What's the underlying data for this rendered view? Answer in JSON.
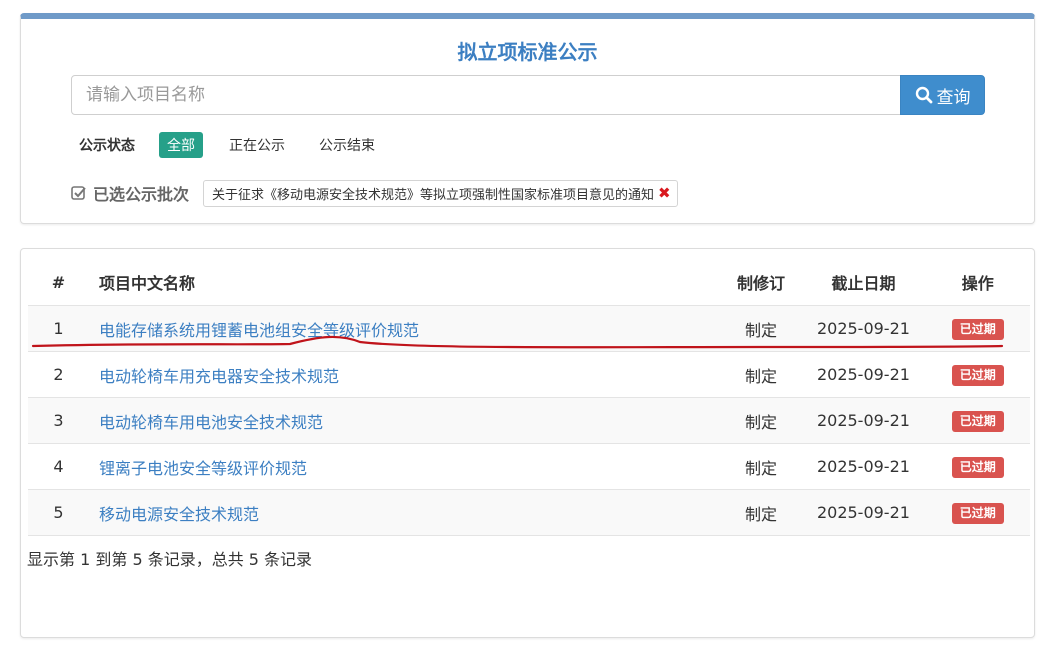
{
  "header": {
    "title": "拟立项标准公示",
    "search_placeholder": "请输入项目名称",
    "search_button": "查询"
  },
  "status_filter": {
    "label": "公示状态",
    "options": [
      "全部",
      "正在公示",
      "公示结束"
    ],
    "active_index": 0
  },
  "batch": {
    "label": "已选公示批次",
    "tag": "关于征求《移动电源安全技术规范》等拟立项强制性国家标准项目意见的通知",
    "tag_remove": "✖"
  },
  "table": {
    "columns": [
      "#",
      "项目中文名称",
      "制修订",
      "截止日期",
      "操作"
    ],
    "rows": [
      {
        "num": "1",
        "name": "电能存储系统用锂蓄电池组安全等级评价规范",
        "revision": "制定",
        "deadline": "2025-09-21",
        "status": "已过期"
      },
      {
        "num": "2",
        "name": "电动轮椅车用充电器安全技术规范",
        "revision": "制定",
        "deadline": "2025-09-21",
        "status": "已过期"
      },
      {
        "num": "3",
        "name": "电动轮椅车用电池安全技术规范",
        "revision": "制定",
        "deadline": "2025-09-21",
        "status": "已过期"
      },
      {
        "num": "4",
        "name": "锂离子电池安全等级评价规范",
        "revision": "制定",
        "deadline": "2025-09-21",
        "status": "已过期"
      },
      {
        "num": "5",
        "name": "移动电源安全技术规范",
        "revision": "制定",
        "deadline": "2025-09-21",
        "status": "已过期"
      }
    ],
    "summary": "显示第 1 到第 5 条记录，总共 5 条记录"
  },
  "colors": {
    "title_blue": "#3c7fc2",
    "active_green": "#26a089",
    "expired_red": "#d9534f",
    "annotation_red": "#c0141b"
  }
}
